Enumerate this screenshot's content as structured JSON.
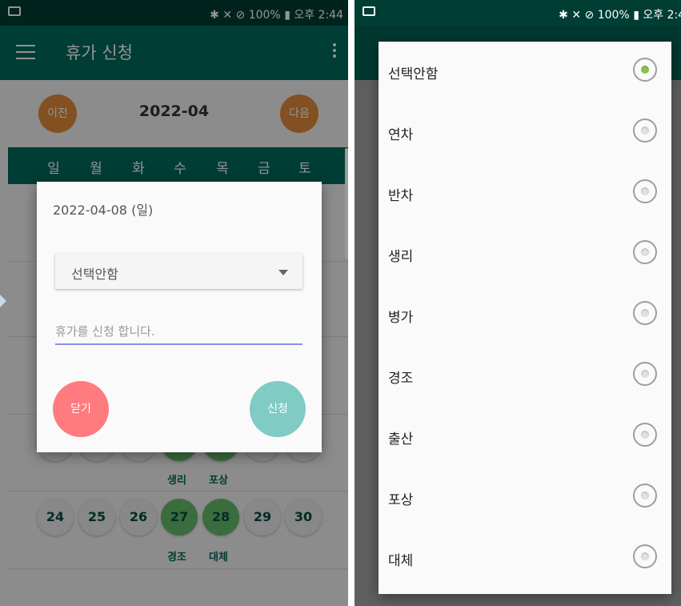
{
  "status_bar": {
    "right_text": "✱ ✕ ⊘ 100% ▮ 오후 2:44"
  },
  "app": {
    "title": "휴가 신청"
  },
  "calendar": {
    "prev_label": "이전",
    "next_label": "다음",
    "month": "2022-04",
    "weekdays": [
      "일",
      "월",
      "화",
      "수",
      "목",
      "금",
      "토"
    ],
    "last_week": [
      "24",
      "25",
      "26",
      "27",
      "28",
      "29",
      "30"
    ],
    "row_labels_above": [
      "생리",
      "포상"
    ],
    "row_labels_below": [
      "경조",
      "대체"
    ]
  },
  "dialog": {
    "date": "2022-04-08 (일)",
    "selected_type": "선택안함",
    "reason_placeholder": "휴가를 신청 합니다.",
    "close_label": "닫기",
    "apply_label": "신청"
  },
  "options": {
    "items": [
      "선택안함",
      "연차",
      "반차",
      "생리",
      "병가",
      "경조",
      "출산",
      "포상",
      "대체"
    ],
    "selected_index": 0
  },
  "colors": {
    "status_bar": "#003d33",
    "app_bar": "#00695c",
    "nav_button": "#e08a3a",
    "close_button": "#ff7b80",
    "apply_button": "#80cbc4",
    "radio_selected": "#8bc34a"
  }
}
